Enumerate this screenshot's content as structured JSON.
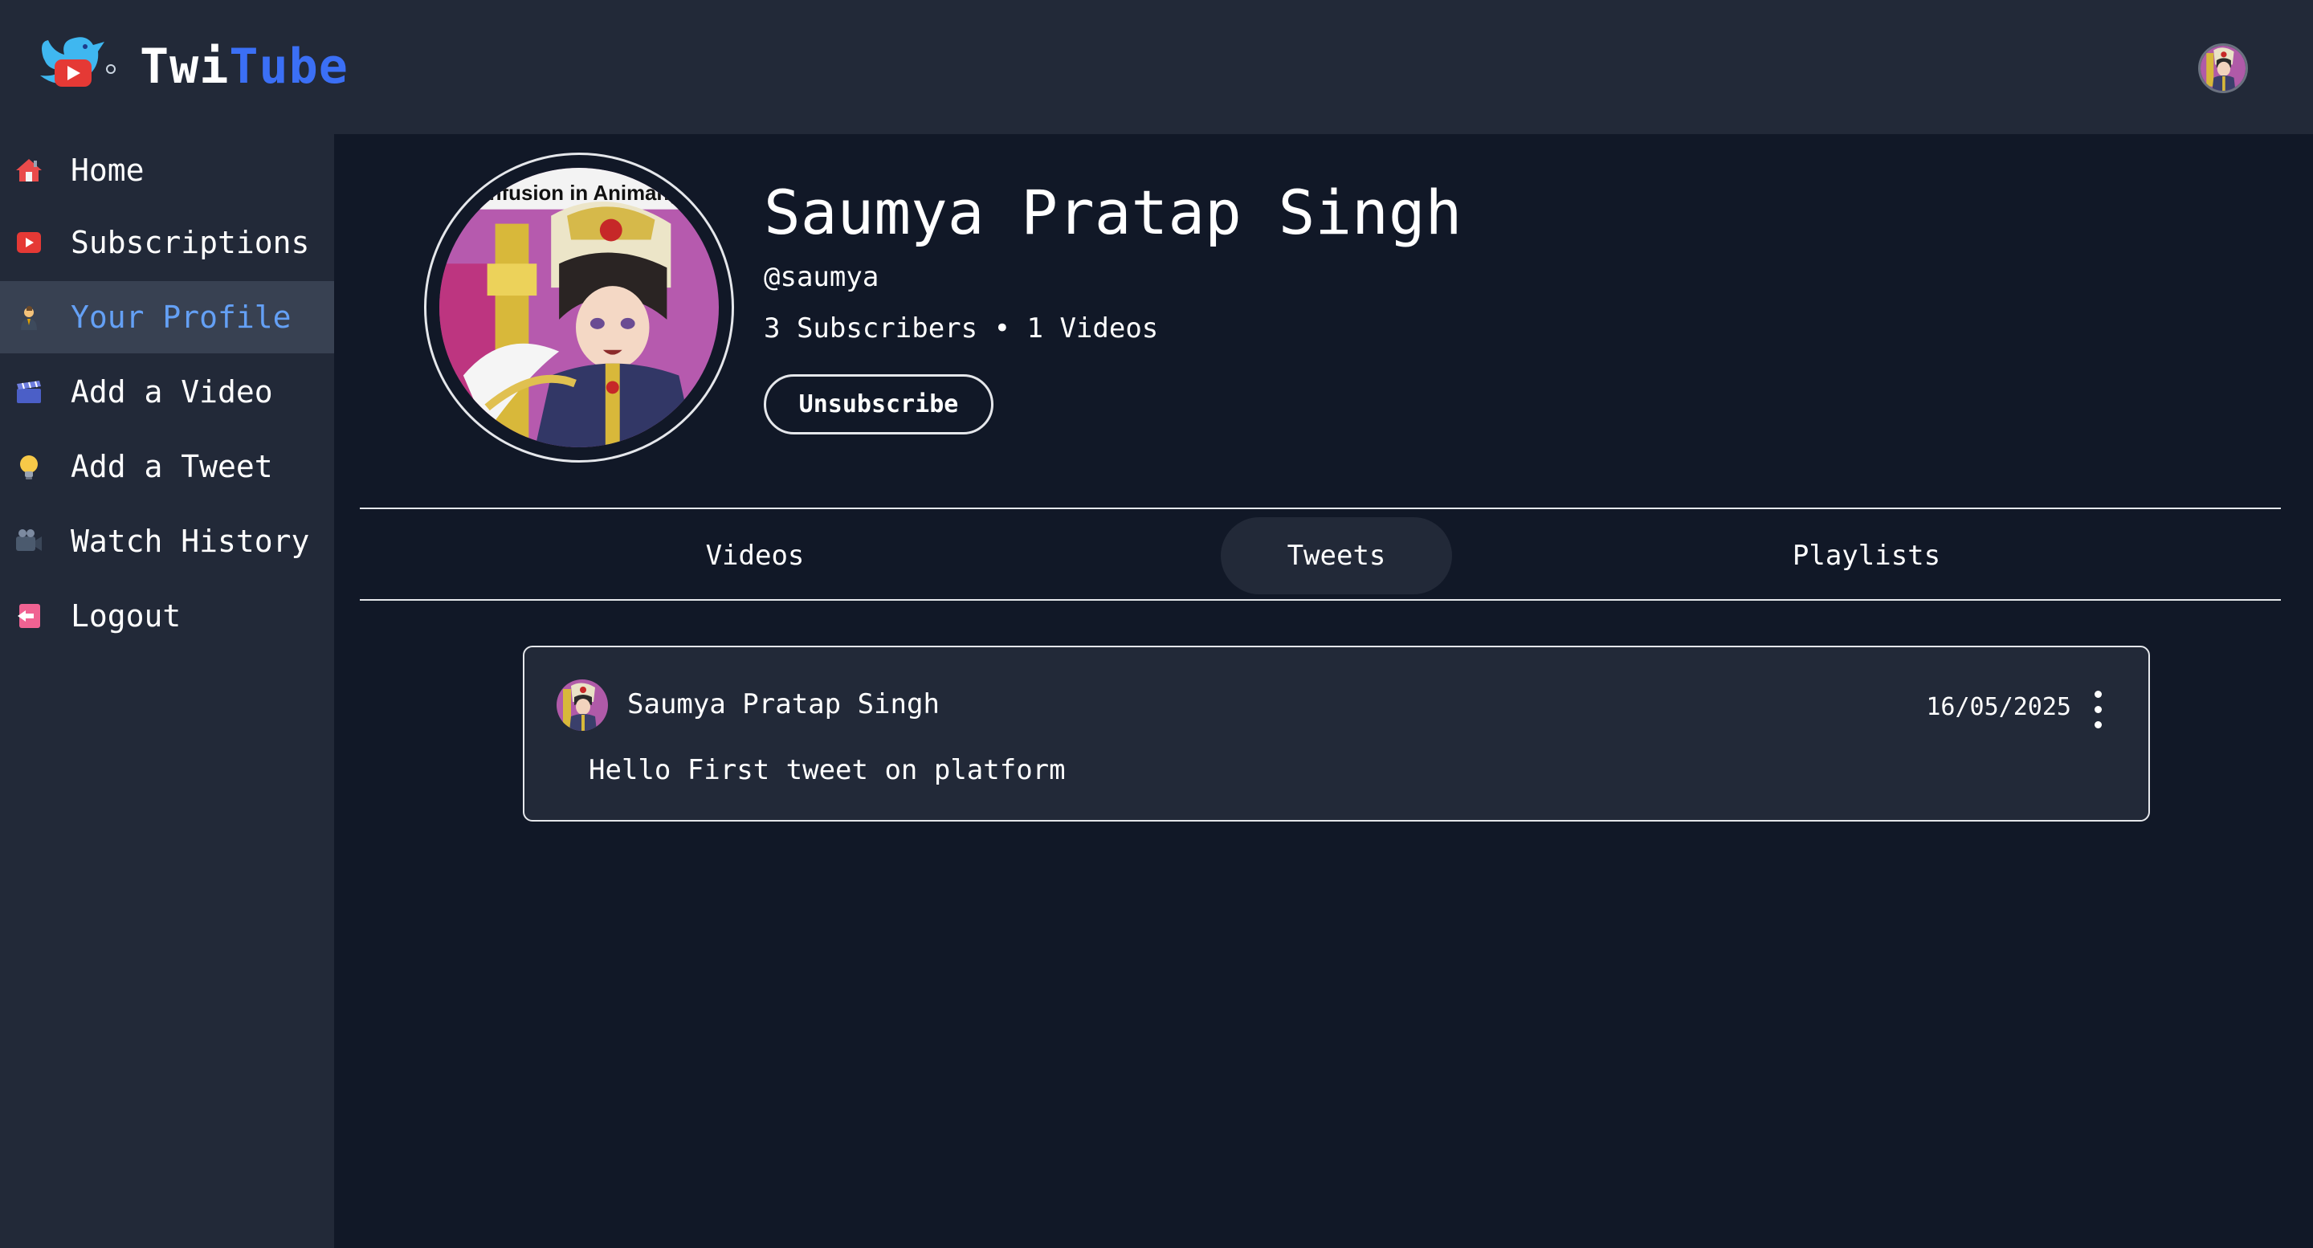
{
  "app": {
    "brand_part1": "Twi",
    "brand_part2": "Tube"
  },
  "sidebar": {
    "items": [
      {
        "label": "Home",
        "icon": "house-icon"
      },
      {
        "label": "Subscriptions",
        "icon": "play-icon"
      },
      {
        "label": "Your Profile",
        "icon": "person-icon",
        "active": true
      },
      {
        "label": "Add a Video",
        "icon": "clapperboard-icon"
      },
      {
        "label": "Add a Tweet",
        "icon": "lightbulb-icon"
      },
      {
        "label": "Watch History",
        "icon": "video-camera-icon"
      },
      {
        "label": "Logout",
        "icon": "logout-icon"
      }
    ]
  },
  "profile": {
    "name": "Saumya Pratap Singh",
    "handle": "@saumya",
    "stats": "3 Subscribers • 1 Videos",
    "button_label": "Unsubscribe",
    "avatar_caption": "onfusion in Animang"
  },
  "tabs": [
    {
      "label": "Videos"
    },
    {
      "label": "Tweets",
      "active": true
    },
    {
      "label": "Playlists"
    }
  ],
  "tweets": [
    {
      "author": "Saumya Pratap Singh",
      "date": "16/05/2025",
      "text": "Hello First tweet on platform"
    }
  ],
  "colors": {
    "accent": "#3b6ff5",
    "active_nav_text": "#64a0f5",
    "sidebar_bg": "#222938",
    "main_bg": "#111827"
  }
}
